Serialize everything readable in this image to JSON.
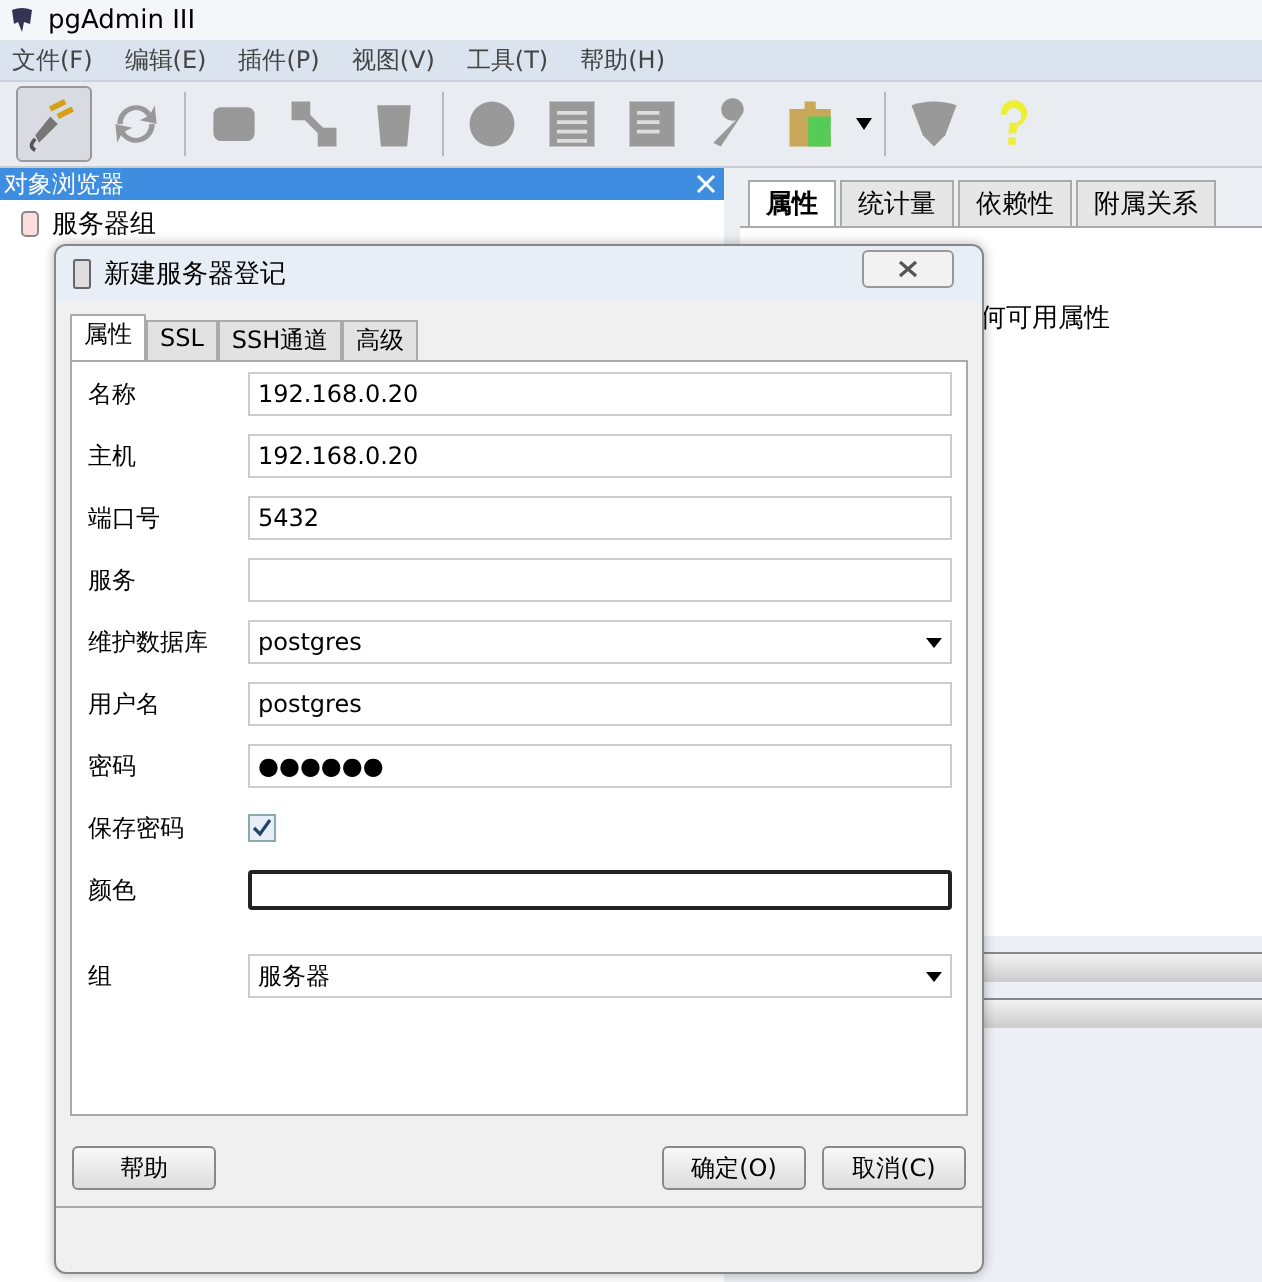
{
  "window": {
    "title": "pgAdmin III"
  },
  "menu": [
    "文件(F)",
    "编辑(E)",
    "插件(P)",
    "视图(V)",
    "工具(T)",
    "帮助(H)"
  ],
  "object_browser": {
    "title": "对象浏览器",
    "tree": [
      {
        "label": "服务器组",
        "expanded": true
      }
    ]
  },
  "right_tabs": [
    {
      "label": "属性",
      "selected": true
    },
    {
      "label": "统计量",
      "selected": false
    },
    {
      "label": "依赖性",
      "selected": false
    },
    {
      "label": "附属关系",
      "selected": false
    }
  ],
  "right_content": {
    "text": "何可用属性"
  },
  "dialog": {
    "title": "新建服务器登记",
    "tabs": [
      {
        "label": "属性",
        "selected": true
      },
      {
        "label": "SSL",
        "selected": false
      },
      {
        "label": "SSH通道",
        "selected": false
      },
      {
        "label": "高级",
        "selected": false
      }
    ],
    "fields": [
      {
        "kind": "text",
        "label": "名称",
        "value": "192.168.0.20"
      },
      {
        "kind": "text",
        "label": "主机",
        "value": "192.168.0.20"
      },
      {
        "kind": "text",
        "label": "端口号",
        "value": "5432"
      },
      {
        "kind": "text",
        "label": "服务"
      },
      {
        "kind": "combo",
        "label": "维护数据库",
        "value": "postgres"
      },
      {
        "kind": "text",
        "label": "用户名",
        "value": "postgres"
      },
      {
        "kind": "password",
        "label": "密码",
        "value": "●●●●●●"
      },
      {
        "kind": "checkbox",
        "label": "保存密码",
        "checked": true
      },
      {
        "kind": "color",
        "label": "颜色"
      },
      {
        "kind": "combo",
        "label": "组",
        "value": "服务器"
      }
    ],
    "buttons": [
      {
        "label": "帮助",
        "kind": "help"
      },
      {
        "label": "确定(O)",
        "kind": "ok"
      },
      {
        "label": "取消(C)",
        "kind": "cancel"
      }
    ]
  }
}
